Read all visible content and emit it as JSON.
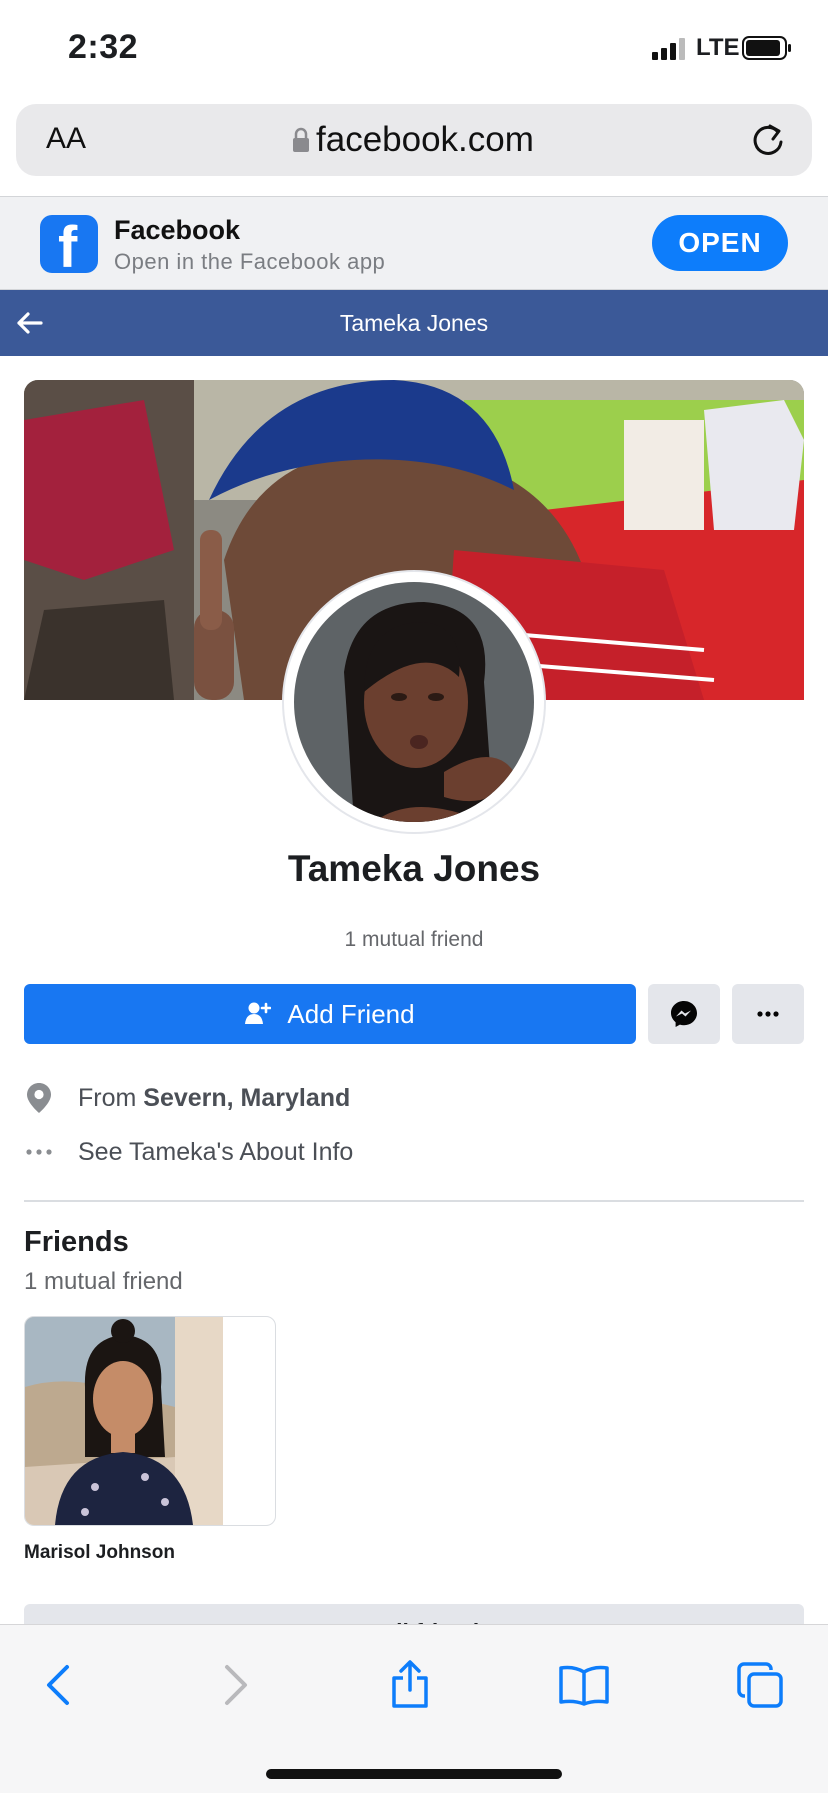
{
  "status_bar": {
    "time": "2:32",
    "network": "LTE"
  },
  "browser": {
    "text_size_label": "AA",
    "url": "facebook.com"
  },
  "app_banner": {
    "app_name": "Facebook",
    "subtitle": "Open in the Facebook app",
    "open_label": "OPEN",
    "logo_letter": "f"
  },
  "nav": {
    "title": "Tameka Jones"
  },
  "profile": {
    "name": "Tameka Jones",
    "mutual_friends": "1 mutual friend",
    "add_friend_label": "Add Friend",
    "from_prefix": "From ",
    "hometown": "Severn, Maryland",
    "about_link": "See Tameka's About Info"
  },
  "friends": {
    "title": "Friends",
    "subtitle": "1 mutual friend",
    "items": [
      {
        "name": "Marisol Johnson"
      }
    ],
    "see_all_label": "See all friends"
  },
  "colors": {
    "facebook_blue": "#1877f2",
    "nav_blue": "#3b5998",
    "ios_blue": "#0d7dfb"
  },
  "icons": [
    "lock-icon",
    "reload-icon",
    "back-arrow-icon",
    "add-person-icon",
    "messenger-icon",
    "more-icon",
    "location-pin-icon",
    "ellipsis-icon",
    "safari-back-icon",
    "safari-forward-icon",
    "share-icon",
    "bookmarks-icon",
    "tabs-icon"
  ]
}
